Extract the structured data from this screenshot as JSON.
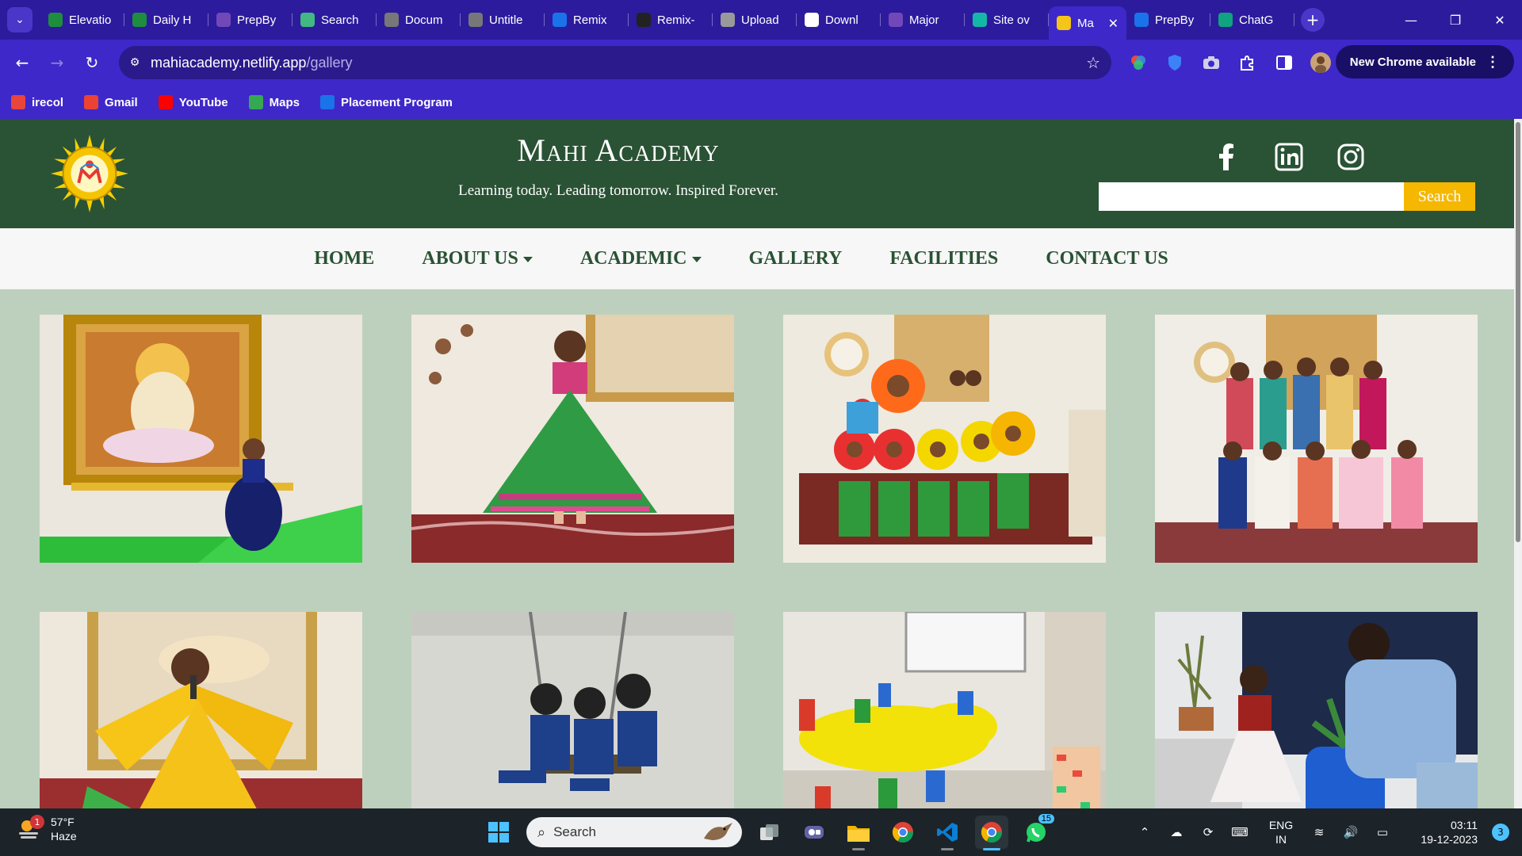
{
  "browser": {
    "tabs": [
      {
        "title": "Elevatio",
        "icon": "sheets-icon",
        "color": "#1e8e3e"
      },
      {
        "title": "Daily H",
        "icon": "sheets-icon",
        "color": "#1e8e3e"
      },
      {
        "title": "PrepBy",
        "icon": "forms-icon",
        "color": "#7248b9"
      },
      {
        "title": "Search",
        "icon": "vue-icon",
        "color": "#42b883"
      },
      {
        "title": "Docum",
        "icon": "globe-icon",
        "color": "#777777"
      },
      {
        "title": "Untitle",
        "icon": "globe-icon",
        "color": "#777777"
      },
      {
        "title": "Remix",
        "icon": "remix-icon",
        "color": "#1a73e8"
      },
      {
        "title": "Remix-",
        "icon": "github-icon",
        "color": "#222222"
      },
      {
        "title": "Upload",
        "icon": "layers-icon",
        "color": "#999999"
      },
      {
        "title": "Downl",
        "icon": "download-icon",
        "color": "#ffffff"
      },
      {
        "title": "Major",
        "icon": "forms-icon",
        "color": "#7248b9"
      },
      {
        "title": "Site ov",
        "icon": "netlify-icon",
        "color": "#14b8a6"
      },
      {
        "title": "Ma",
        "icon": "academy-logo-icon",
        "color": "#f5c518",
        "active": true
      },
      {
        "title": "PrepBy",
        "icon": "pb-icon",
        "color": "#1a73e8"
      },
      {
        "title": "ChatG",
        "icon": "chatgpt-icon",
        "color": "#10a37f"
      }
    ],
    "url_host": "mahiacademy.netlify.app",
    "url_path": "/gallery",
    "update_label": "New Chrome available",
    "bookmarks": [
      {
        "label": "irecol",
        "icon": "irecol-icon",
        "color": "#e8453c"
      },
      {
        "label": "Gmail",
        "icon": "gmail-icon",
        "color": "#ea4335"
      },
      {
        "label": "YouTube",
        "icon": "youtube-icon",
        "color": "#ff0000"
      },
      {
        "label": "Maps",
        "icon": "maps-icon",
        "color": "#34a853"
      },
      {
        "label": "Placement Program",
        "icon": "pb-icon",
        "color": "#1a73e8"
      }
    ]
  },
  "site": {
    "title": "Mahi Academy",
    "tagline": "Learning today. Leading tomorrow. Inspired Forever.",
    "search_button": "Search",
    "search_placeholder": "",
    "nav": [
      {
        "label": "HOME",
        "dropdown": false
      },
      {
        "label": "ABOUT US",
        "dropdown": true
      },
      {
        "label": "ACADEMIC",
        "dropdown": true
      },
      {
        "label": "GALLERY",
        "dropdown": false
      },
      {
        "label": "FACILITIES",
        "dropdown": false
      },
      {
        "label": "CONTACT US",
        "dropdown": false
      }
    ],
    "social": [
      "facebook-icon",
      "linkedin-icon",
      "instagram-icon"
    ],
    "gallery_count": 8
  },
  "taskbar": {
    "weather_temp": "57°F",
    "weather_desc": "Haze",
    "weather_badge": "1",
    "search_label": "Search",
    "lang_top": "ENG",
    "lang_bottom": "IN",
    "time": "03:11",
    "date": "19-12-2023",
    "notifications": "3",
    "whatsapp_badge": "15"
  },
  "colors": {
    "chrome_frame": "#2d1b9e",
    "site_header": "#2a5234",
    "search_button": "#f5b700",
    "page_background": "#bdd0bd"
  }
}
